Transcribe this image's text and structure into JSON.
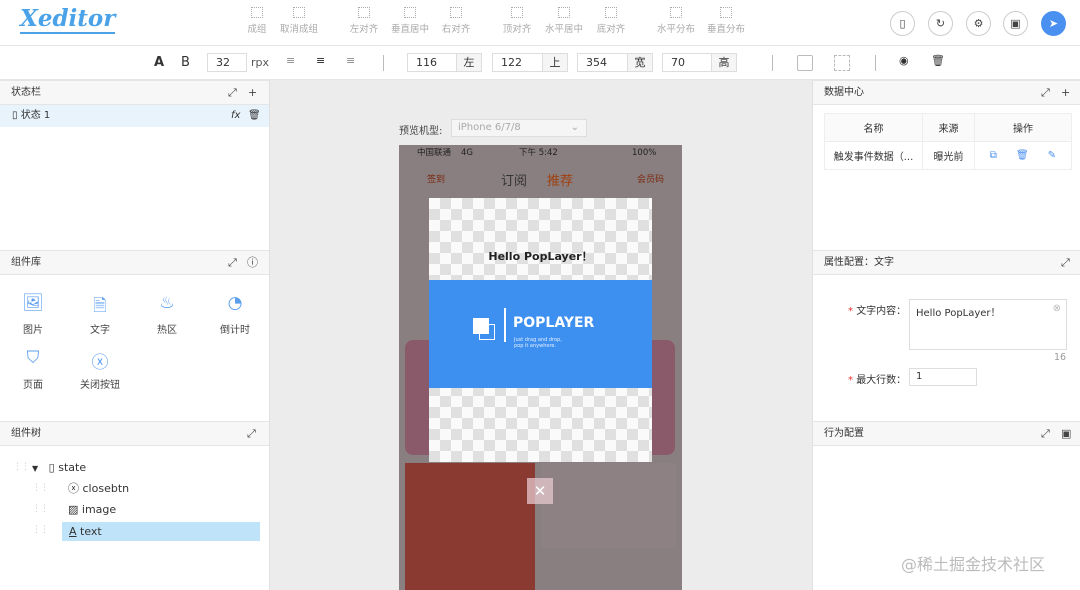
{
  "header": {
    "logo": "Xeditor",
    "tools": [
      "成组",
      "取消成组",
      "左对齐",
      "垂直居中",
      "右对齐",
      "顶对齐",
      "水平居中",
      "底对齐",
      "水平分布",
      "垂直分布"
    ]
  },
  "toolbar": {
    "font_a": "A",
    "font_b": "B",
    "font_size": "32",
    "font_unit": "rpx",
    "left": "116",
    "left_label": "左",
    "top": "122",
    "top_label": "上",
    "width": "354",
    "width_label": "宽",
    "height": "70",
    "height_label": "高"
  },
  "left": {
    "state_panel": {
      "title": "状态栏",
      "items": [
        {
          "label": "状态 1"
        }
      ],
      "fx": "fx"
    },
    "library": {
      "title": "组件库",
      "items": [
        {
          "label": "图片",
          "icon": "image-icon"
        },
        {
          "label": "文字",
          "icon": "document-icon"
        },
        {
          "label": "热区",
          "icon": "flame-icon"
        },
        {
          "label": "倒计时",
          "icon": "dashboard-icon"
        },
        {
          "label": "页面",
          "icon": "html5-icon"
        },
        {
          "label": "关闭按钮",
          "icon": "close-circle-icon"
        }
      ]
    },
    "tree": {
      "title": "组件树",
      "root": "state",
      "children": [
        "closebtn",
        "image",
        "text"
      ],
      "selected": "text"
    }
  },
  "preview": {
    "label": "预览机型:",
    "device": "iPhone 6/7/8",
    "status_carrier": "中国联通",
    "status_net": "4G",
    "status_time": "下午 5:42",
    "status_battery": "100%",
    "tab_1": "订阅",
    "tab_2": "推荐",
    "sign": "签到",
    "member": "会员码",
    "popup_text": "Hello PopLayer！",
    "banner_title": "POPLAYER",
    "banner_sub_1": "Just drag and drop,",
    "banner_sub_2": "pop it anywhere.",
    "close_glyph": "✕"
  },
  "right": {
    "data_center": {
      "title": "数据中心",
      "columns": [
        "名称",
        "来源",
        "操作"
      ],
      "rows": [
        {
          "name": "触发事件数据（...",
          "source": "曝光前"
        }
      ]
    },
    "props": {
      "title": "属性配置：文字",
      "text_label": "文字内容：",
      "text_value": "Hello PopLayer！",
      "char_count": "16",
      "lines_label": "最大行数：",
      "lines_value": "1"
    },
    "behavior": {
      "title": "行为配置"
    }
  },
  "watermark": "@稀土掘金技术社区",
  "colors": {
    "accent": "#4a90f0",
    "banner": "#3d8ff0",
    "selected": "#bfe3f9"
  }
}
